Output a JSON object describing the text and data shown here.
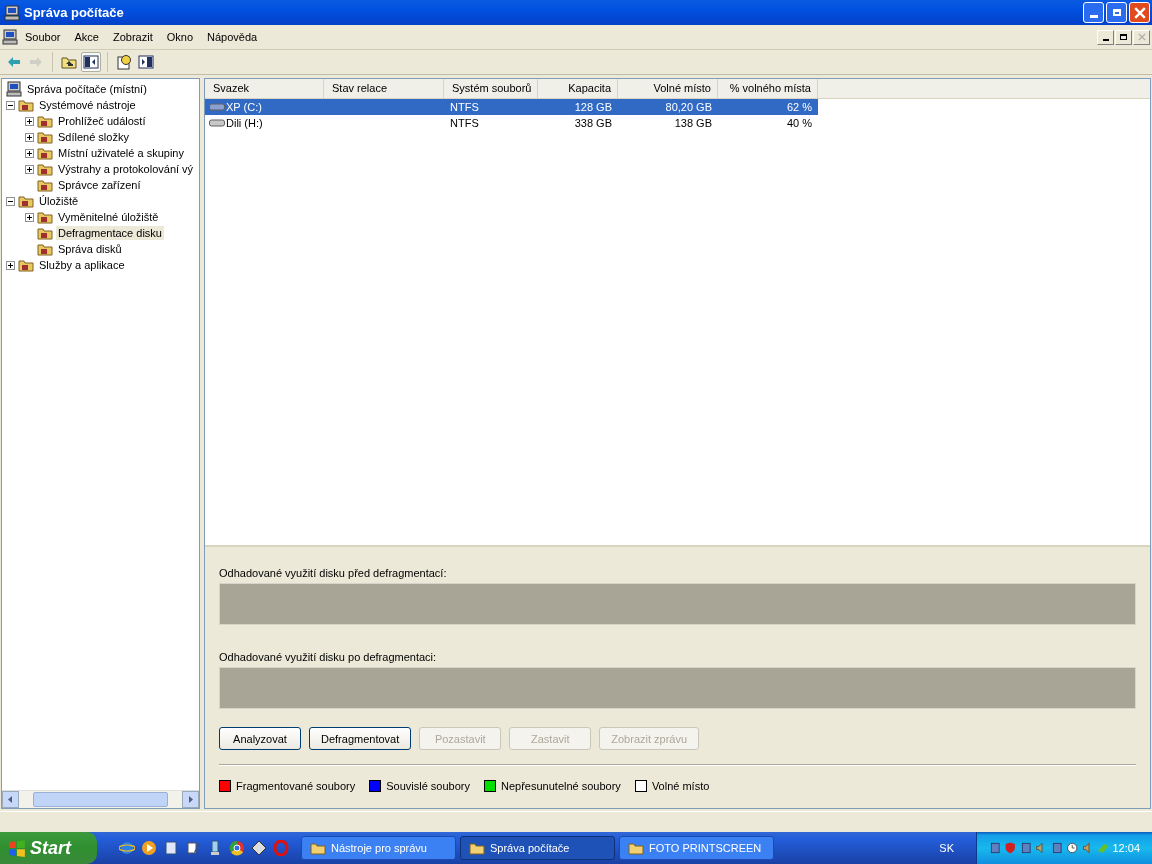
{
  "window": {
    "title": "Správa počítače"
  },
  "menu": [
    "Soubor",
    "Akce",
    "Zobrazit",
    "Okno",
    "Nápověda"
  ],
  "toolbar": [
    {
      "kind": "back",
      "disabled": false,
      "pressed": false
    },
    {
      "kind": "forward",
      "disabled": true,
      "pressed": false
    },
    {
      "kind": "up",
      "disabled": false,
      "pressed": false
    },
    {
      "kind": "tree",
      "disabled": false,
      "pressed": true
    },
    {
      "kind": "help",
      "disabled": false,
      "pressed": false
    },
    {
      "kind": "panel",
      "disabled": false,
      "pressed": false
    }
  ],
  "tree": [
    {
      "label": "Správa počítače (místní)",
      "selected": false,
      "children": [
        {
          "label": "Systémové nástroje",
          "selected": false,
          "expanded": true,
          "children": [
            {
              "label": "Prohlížeč událostí",
              "selected": false,
              "expanded": false
            },
            {
              "label": "Sdílené složky",
              "selected": false,
              "expanded": false
            },
            {
              "label": "Místní uživatelé a skupiny",
              "selected": false,
              "expanded": false
            },
            {
              "label": "Výstrahy a protokolování vý",
              "selected": false,
              "expanded": false
            },
            {
              "label": "Správce zařízení",
              "selected": false
            }
          ]
        },
        {
          "label": "Úložiště",
          "selected": false,
          "expanded": true,
          "children": [
            {
              "label": "Vyměnitelné úložiště",
              "selected": false,
              "expanded": false
            },
            {
              "label": "Defragmentace disku",
              "selected": true
            },
            {
              "label": "Správa disků",
              "selected": false
            }
          ]
        },
        {
          "label": "Služby a aplikace",
          "selected": false,
          "expanded": false
        }
      ]
    }
  ],
  "table": {
    "columns": [
      "Svazek",
      "Stav relace",
      "Systém souborů",
      "Kapacita",
      "Volné místo",
      "% volného místa"
    ],
    "rows": [
      {
        "selected": true,
        "cells": [
          "XP (C:)",
          "",
          "NTFS",
          "128 GB",
          "80,20 GB",
          "62 %"
        ]
      },
      {
        "selected": false,
        "cells": [
          "Dili (H:)",
          "",
          "NTFS",
          "338 GB",
          "138 GB",
          "40 %"
        ]
      }
    ]
  },
  "defrag": {
    "before_label": "Odhadované využití disku před defragmentací:",
    "after_label": "Odhadované využití disku po defragmentaci:",
    "buttons": [
      {
        "label": "Analyzovat",
        "disabled": false
      },
      {
        "label": "Defragmentovat",
        "disabled": false
      },
      {
        "label": "Pozastavit",
        "disabled": true
      },
      {
        "label": "Zastavit",
        "disabled": true
      },
      {
        "label": "Zobrazit zprávu",
        "disabled": true
      }
    ],
    "legend": [
      {
        "label": "Fragmentované soubory",
        "color": "#ff0000"
      },
      {
        "label": "Souvislé soubory",
        "color": "#0000ff"
      },
      {
        "label": "Nepřesunutelné soubory",
        "color": "#00e000"
      },
      {
        "label": "Volné místo",
        "color": "#ffffff"
      }
    ]
  },
  "taskbar": {
    "start": "Start",
    "tasks": [
      {
        "label": "Nástroje pro správu",
        "selected": false
      },
      {
        "label": "Správa počítače",
        "selected": true
      },
      {
        "label": "FOTO PRINTSCREEN",
        "selected": false
      }
    ],
    "language": "SK",
    "clock": "12:04"
  }
}
